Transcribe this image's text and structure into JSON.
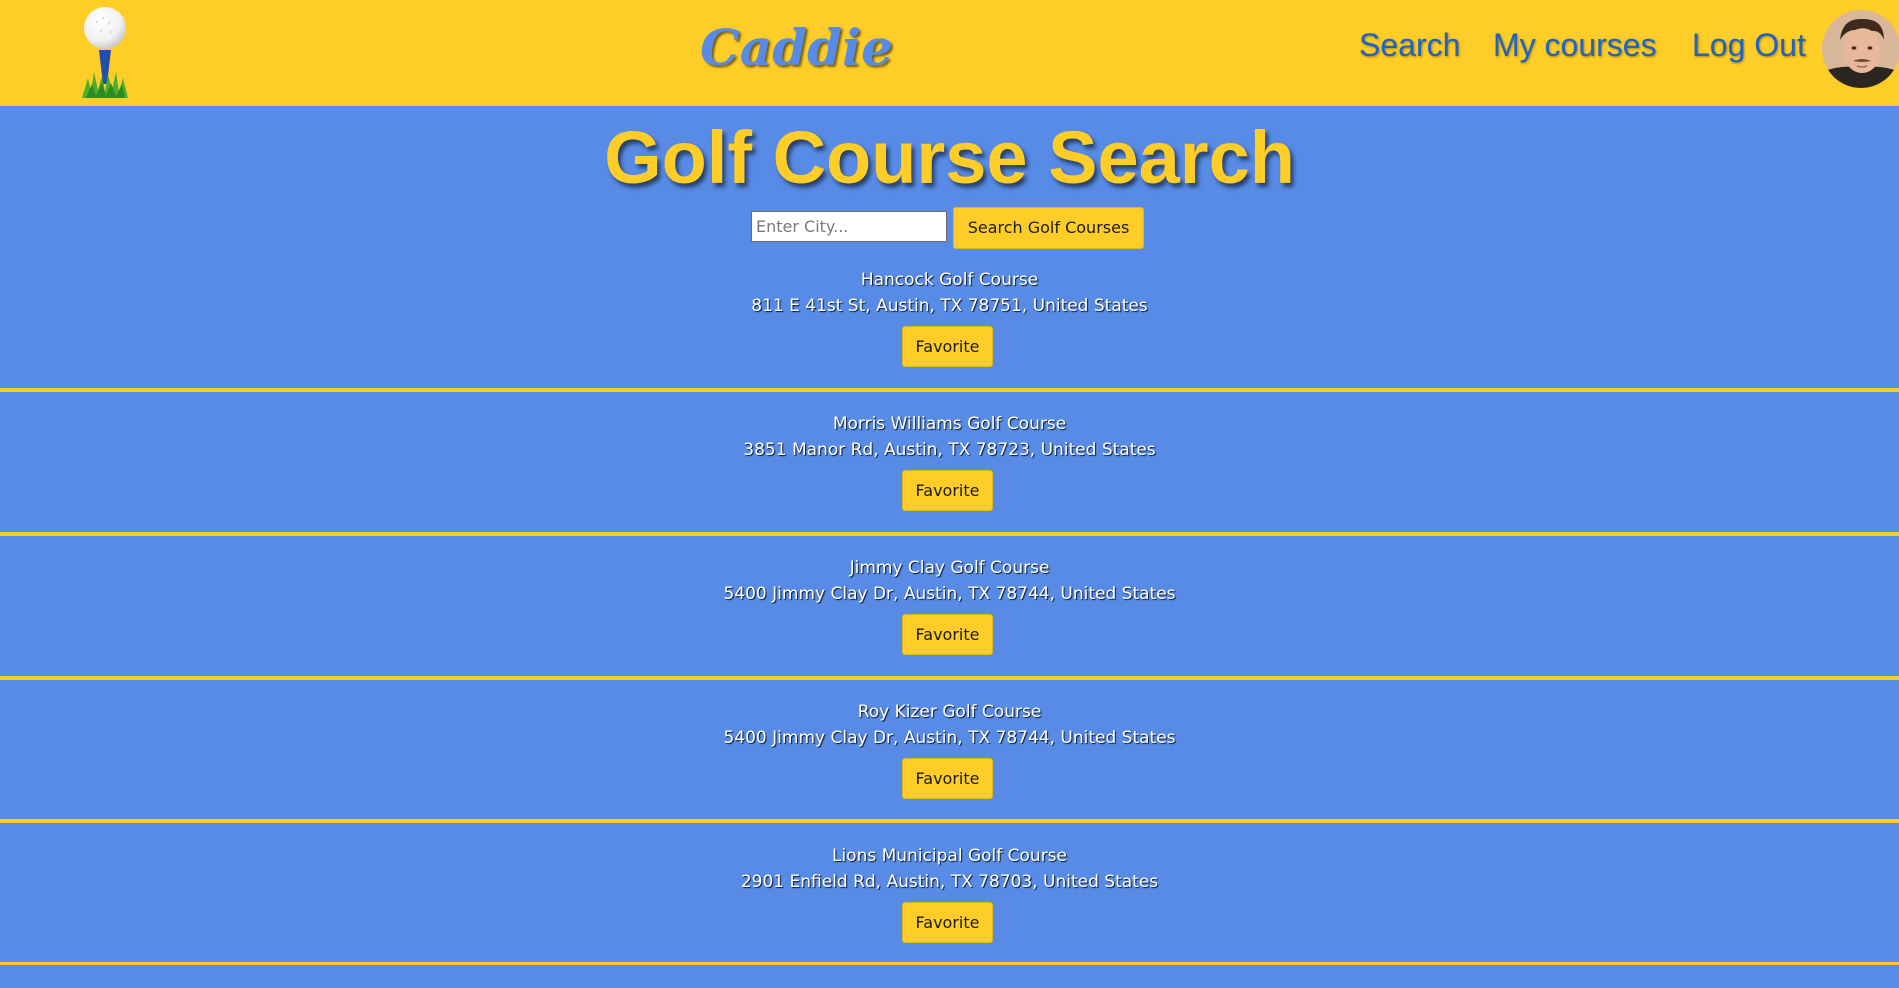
{
  "header": {
    "brand": "Caddie",
    "nav": {
      "search": "Search",
      "my_courses": "My courses",
      "log_out": "Log Out"
    }
  },
  "main": {
    "title": "Golf Course Search",
    "search_placeholder": "Enter City...",
    "search_button": "Search Golf Courses",
    "courses": [
      {
        "name": "Hancock Golf Course",
        "address": "811 E 41st St, Austin, TX 78751, United States",
        "button": "Favorite"
      },
      {
        "name": "Morris Williams Golf Course",
        "address": "3851 Manor Rd, Austin, TX 78723, United States",
        "button": "Favorite"
      },
      {
        "name": "Jimmy Clay Golf Course",
        "address": "5400 Jimmy Clay Dr, Austin, TX 78744, United States",
        "button": "Favorite"
      },
      {
        "name": "Roy Kizer Golf Course",
        "address": "5400 Jimmy Clay Dr, Austin, TX 78744, United States",
        "button": "Favorite"
      },
      {
        "name": "Lions Municipal Golf Course",
        "address": "2901 Enfield Rd, Austin, TX 78703, United States",
        "button": "Favorite"
      }
    ]
  },
  "colors": {
    "header_bg": "#ffcd27",
    "page_bg": "#578be6",
    "nav_link": "#1f63c4",
    "accent": "#ffcd27"
  },
  "icons": {
    "logo": "golf-ball-on-tee-icon",
    "avatar": "user-avatar"
  }
}
